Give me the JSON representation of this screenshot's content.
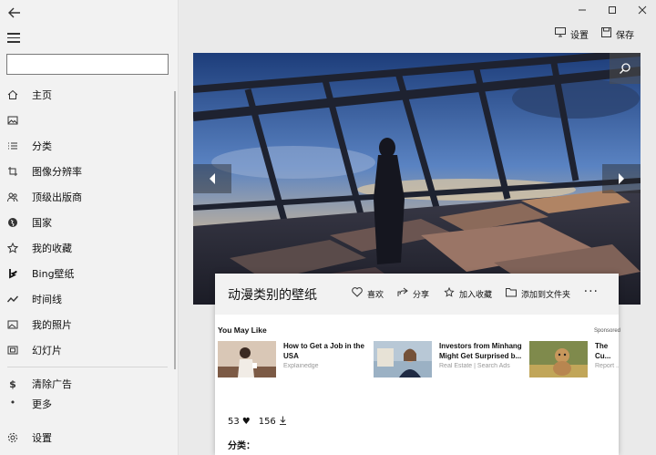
{
  "sidebar": {
    "search_value": "",
    "items": [
      {
        "label": "主页",
        "icon": "home-icon"
      },
      {
        "label": "",
        "icon": "image-icon"
      },
      {
        "label": "分类",
        "icon": "list-icon"
      },
      {
        "label": "图像分辨率",
        "icon": "crop-icon"
      },
      {
        "label": "顶级出版商",
        "icon": "people-icon"
      },
      {
        "label": "国家",
        "icon": "globe-icon"
      },
      {
        "label": "我的收藏",
        "icon": "star-icon"
      },
      {
        "label": "Bing壁纸",
        "icon": "bing-icon"
      },
      {
        "label": "时间线",
        "icon": "timeline-icon"
      },
      {
        "label": "我的照片",
        "icon": "photo-icon"
      },
      {
        "label": "幻灯片",
        "icon": "slideshow-icon"
      }
    ],
    "bottom_items": [
      {
        "label": "清除广告",
        "icon": "dollar-icon"
      },
      {
        "label": "更多",
        "icon": "more-icon"
      }
    ],
    "settings_label": "设置"
  },
  "toolbar": {
    "settings_label": "设置",
    "save_label": "保存"
  },
  "card": {
    "title": "动漫类别的壁纸",
    "actions": {
      "like": "喜欢",
      "share": "分享",
      "add_favorite": "加入收藏",
      "add_folder": "添加到文件夹"
    },
    "more": "···",
    "likes": "53",
    "downloads": "156",
    "category_label": "分类："
  },
  "ads": {
    "title": "You May Like",
    "sponsored": "Sponsored",
    "items": [
      {
        "title": "How to Get a Job in the USA",
        "source": "Explainedge"
      },
      {
        "title": "Investors from Minhang Might Get Surprised b...",
        "source": "Real Estate | Search Ads"
      },
      {
        "title": "The Cu... Breeds",
        "source": "Report ..."
      }
    ]
  },
  "colors": {
    "accent": "#1a1a1a",
    "sidebar_bg": "#f2f2f2",
    "card_header_bg": "#f2f2f2"
  }
}
